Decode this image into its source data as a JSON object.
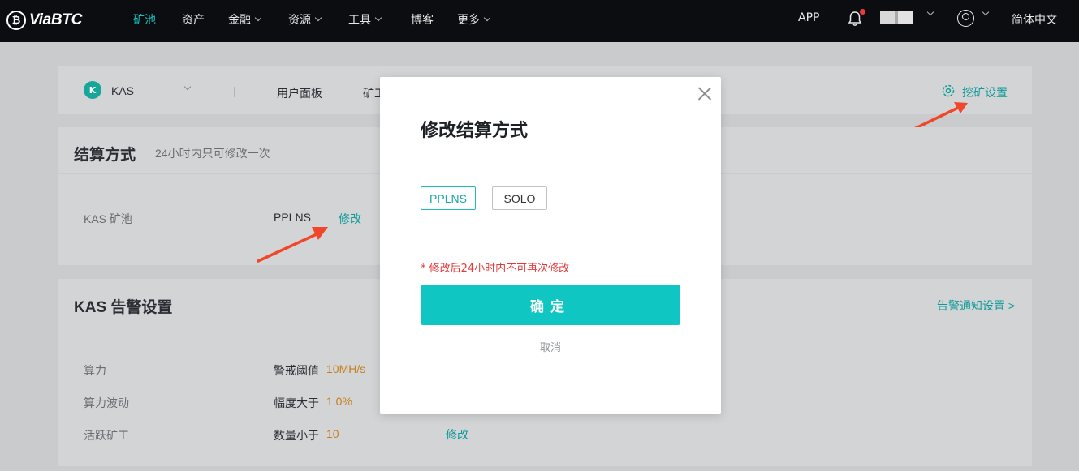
{
  "nav": {
    "logo_text": "ViaBTC",
    "items": [
      {
        "label": "矿池"
      },
      {
        "label": "资产"
      },
      {
        "label": "金融"
      },
      {
        "label": "资源"
      },
      {
        "label": "工具"
      },
      {
        "label": "博客"
      },
      {
        "label": "更多"
      }
    ],
    "app_label": "APP",
    "language_label": "简体中文"
  },
  "subnav": {
    "coin": "KAS",
    "coin_icon_letter": "K",
    "tab_dashboard": "用户面板",
    "tab_miner": "矿工",
    "mining_settings": "挖矿设置"
  },
  "settlement": {
    "title": "结算方式",
    "note": "24小时内只可修改一次",
    "pool_label": "KAS 矿池",
    "pool_value": "PPLNS",
    "edit_label": "修改"
  },
  "alerts": {
    "title": "KAS 告警设置",
    "notify_link": "告警通知设置 >",
    "rows": [
      {
        "label": "算力",
        "cond": "警戒阈值",
        "value": "10MH/s"
      },
      {
        "label": "算力波动",
        "cond": "幅度大于",
        "value": "1.0%"
      },
      {
        "label": "活跃矿工",
        "cond": "数量小于",
        "value": "10"
      }
    ],
    "edit_label": "修改"
  },
  "modal": {
    "title": "修改结算方式",
    "options": [
      "PPLNS",
      "SOLO"
    ],
    "selected": "PPLNS",
    "warning": "* 修改后24小时内不可再次修改",
    "confirm": "确定",
    "cancel": "取消"
  },
  "colors": {
    "accent": "#10c6c3",
    "warning": "#e03b3b",
    "nav_bg": "#0b0d10"
  }
}
